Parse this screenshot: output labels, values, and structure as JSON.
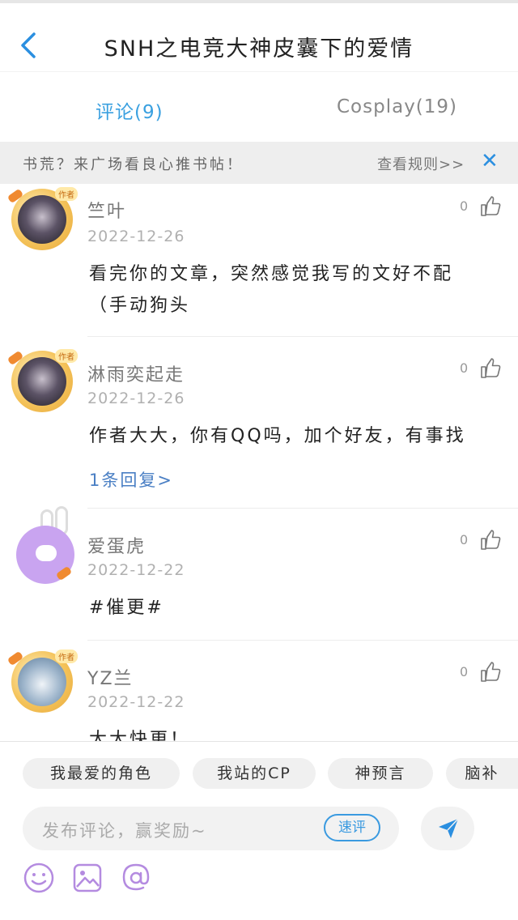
{
  "header": {
    "title": "SNH之电竞大神皮囊下的爱情"
  },
  "tabs": [
    {
      "label": "评论(9)"
    },
    {
      "label": "Cosplay(19)"
    }
  ],
  "notice": {
    "text": "书荒？来广场看良心推书帖！",
    "link": "查看规则>>",
    "close": "✕"
  },
  "comments": [
    {
      "user": "竺叶",
      "date": "2022-12-26",
      "likes": "0",
      "avatar_tag": "作者",
      "text": "看完你的文章，突然感觉我写的文好不配（手动狗头",
      "reply": ""
    },
    {
      "user": "淋雨奕起走",
      "date": "2022-12-26",
      "likes": "0",
      "avatar_tag": "作者",
      "text": "作者大大，你有QQ吗，加个好友，有事找",
      "reply": "1条回复>"
    },
    {
      "user": "爱蛋虎",
      "date": "2022-12-22",
      "likes": "0",
      "avatar_tag": "",
      "text": "#催更#",
      "reply": ""
    },
    {
      "user": "YZ兰",
      "date": "2022-12-22",
      "likes": "0",
      "avatar_tag": "作者",
      "text": "大大快更！",
      "reply": ""
    }
  ],
  "bottom": {
    "chips": [
      "我最爱的角色",
      "我站的CP",
      "神预言",
      "脑补"
    ],
    "input_placeholder": "发布评论，赢奖励~",
    "quick_label": "速评"
  },
  "colors": {
    "accent": "#3aa0e0",
    "reply": "#4a7fc4",
    "close": "#2b8fe0",
    "tool_purple": "#b48be0"
  }
}
